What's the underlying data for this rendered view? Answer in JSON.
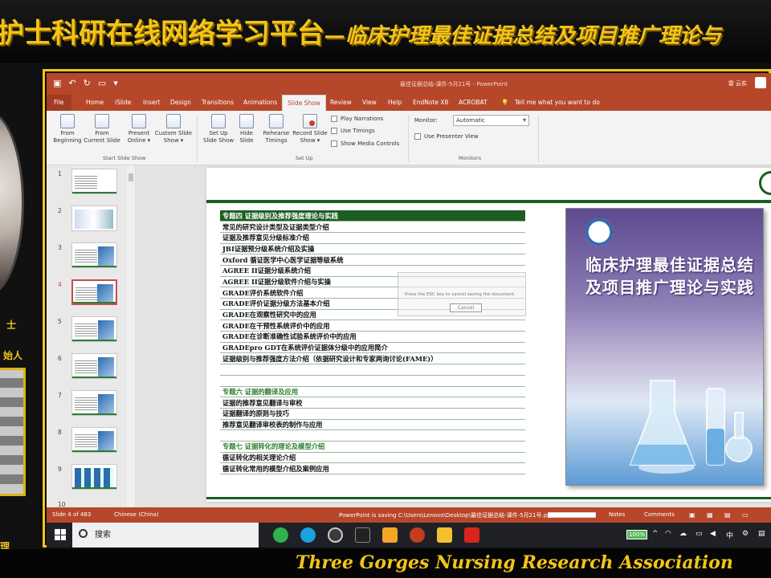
{
  "banner": {
    "title": "护士科研在线网络学习平台",
    "subtitle": "—临床护理最佳证据总结及项目推广理论与"
  },
  "left_panel": {
    "text_1": "士",
    "text_2": "始人",
    "text_3": "理"
  },
  "footer_text": "Three Gorges Nursing Research Association",
  "ppt": {
    "window_title": "最佳证据总结-课件-5月21号 - PowerPoint",
    "user": "雷 云实",
    "tabs": {
      "file": "File",
      "home": "Home",
      "islide": "iSlide",
      "insert": "Insert",
      "design": "Design",
      "transitions": "Transitions",
      "animations": "Animations",
      "slideshow": "Slide Show",
      "review": "Review",
      "view": "View",
      "help": "Help",
      "endnote": "EndNote X8",
      "acrobat": "ACROBAT",
      "tellme": "Tell me what you want to do"
    },
    "ribbon": {
      "from_beginning": [
        "From",
        "Beginning"
      ],
      "from_current": [
        "From",
        "Current Slide"
      ],
      "present_online": [
        "Present",
        "Online ▾"
      ],
      "custom_show": [
        "Custom Slide",
        "Show ▾"
      ],
      "start_group": "Start Slide Show",
      "setup_show": [
        "Set Up",
        "Slide Show"
      ],
      "hide_slide": [
        "Hide",
        "Slide"
      ],
      "rehearse": [
        "Rehearse",
        "Timings"
      ],
      "record": [
        "Record Slide",
        "Show ▾"
      ],
      "play_narrations": "Play Narrations",
      "use_timings": "Use Timings",
      "show_media": "Show Media Controls",
      "setup_group": "Set Up",
      "monitor_label": "Monitor:",
      "monitor_value": "Automatic",
      "presenter_view": "Use Presenter View",
      "monitors_group": "Monitors"
    },
    "thumbnails": [
      "1",
      "2",
      "3",
      "4",
      "5",
      "6",
      "7",
      "8",
      "9",
      "10"
    ],
    "selected_slide": 4,
    "toc": [
      {
        "kind": "hdr",
        "text": "专题四 证据级别及推荐强度理论与实践"
      },
      {
        "kind": "row",
        "text": "常见的研究设计类型及证据类型介绍"
      },
      {
        "kind": "row",
        "text": "证据及推荐意见分级标准介绍"
      },
      {
        "kind": "row",
        "text": "JBI证据预分级系统介绍及实操"
      },
      {
        "kind": "row",
        "text": "Oxford 循证医学中心医学证据等级系统"
      },
      {
        "kind": "row",
        "text": "AGREE II证据分级系统介绍"
      },
      {
        "kind": "row",
        "text": "AGREE II证据分级软件介绍与实操"
      },
      {
        "kind": "row",
        "text": "GRADE评价系统软件介绍"
      },
      {
        "kind": "row",
        "text": "GRADE评价证据分级方法基本介绍"
      },
      {
        "kind": "row",
        "text": "GRADE在观察性研究中的应用"
      },
      {
        "kind": "row",
        "text": "GRADE在干预性系统评价中的应用"
      },
      {
        "kind": "row",
        "text": "GRADE在诊断准确性试验系统评价中的应用"
      },
      {
        "kind": "row",
        "text": "GRADEpro GDT在系统评价证据体分级中的应用简介"
      },
      {
        "kind": "row",
        "text": "证据级别与推荐强度方法介绍（依据研究设计和专家两询讨论(FAME)）"
      },
      {
        "kind": "empty",
        "text": ""
      },
      {
        "kind": "empty",
        "text": ""
      },
      {
        "kind": "gh",
        "text": "专题六 证据的翻译及应用"
      },
      {
        "kind": "row",
        "text": "证据的推荐意见翻译与审校"
      },
      {
        "kind": "row",
        "text": "证据翻译的原则与技巧"
      },
      {
        "kind": "row",
        "text": "推荐意见翻译审校表的制作与应用"
      },
      {
        "kind": "empty",
        "text": ""
      },
      {
        "kind": "gh",
        "text": "专题七 证据转化的理论及模型介绍"
      },
      {
        "kind": "row",
        "text": "循证转化的相关理论介绍"
      },
      {
        "kind": "row",
        "text": "循证转化常用的模型介绍及案例应用"
      }
    ],
    "book_title": "临床护理最佳证据总结及项目推广理论与实践",
    "dialog_text": "Press the ESC key to cancel saving the document.",
    "dialog_cancel": "Cancel",
    "status": {
      "slide": "Slide 4 of 483",
      "language": "Chinese (China)",
      "saving": "PowerPoint is saving C:\\Users\\Lenovo\\Desktop\\最佳证据总结-课件-5月21号.pptx...",
      "notes": "Notes",
      "comments": "Comments"
    }
  },
  "taskbar": {
    "search_placeholder": "搜索",
    "battery": "100%",
    "ime": "中"
  },
  "colors": {
    "ppt_accent": "#b7472a",
    "banner_gold": "#f2c517",
    "slide_green": "#1b5e20"
  }
}
